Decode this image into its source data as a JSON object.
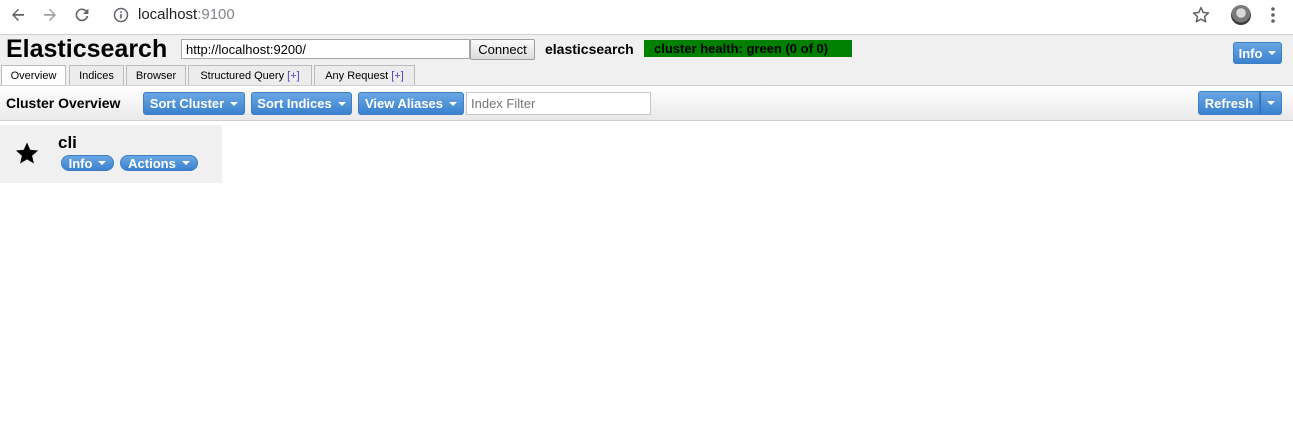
{
  "browser": {
    "url_host": "localhost",
    "url_port": ":9100"
  },
  "header": {
    "title": "Elasticsearch",
    "url_value": "http://localhost:9200/",
    "connect_label": "Connect",
    "cluster_name": "elasticsearch",
    "cluster_health": "cluster health: green (0 of 0)",
    "health_color": "#008000",
    "info_label": "Info"
  },
  "tabs": [
    {
      "label": "Overview",
      "plus": ""
    },
    {
      "label": "Indices",
      "plus": ""
    },
    {
      "label": "Browser",
      "plus": ""
    },
    {
      "label": "Structured Query ",
      "plus": "[+]"
    },
    {
      "label": "Any Request ",
      "plus": "[+]"
    }
  ],
  "toolbar": {
    "title": "Cluster Overview",
    "sort_cluster": "Sort Cluster",
    "sort_indices": "Sort Indices",
    "view_aliases": "View Aliases",
    "index_filter_placeholder": "Index Filter",
    "refresh": "Refresh"
  },
  "node": {
    "name": "cli",
    "info_label": "Info",
    "actions_label": "Actions",
    "icon": "star-icon"
  },
  "colors": {
    "accent": "#3a81cf",
    "panel": "#f0f0f0"
  }
}
